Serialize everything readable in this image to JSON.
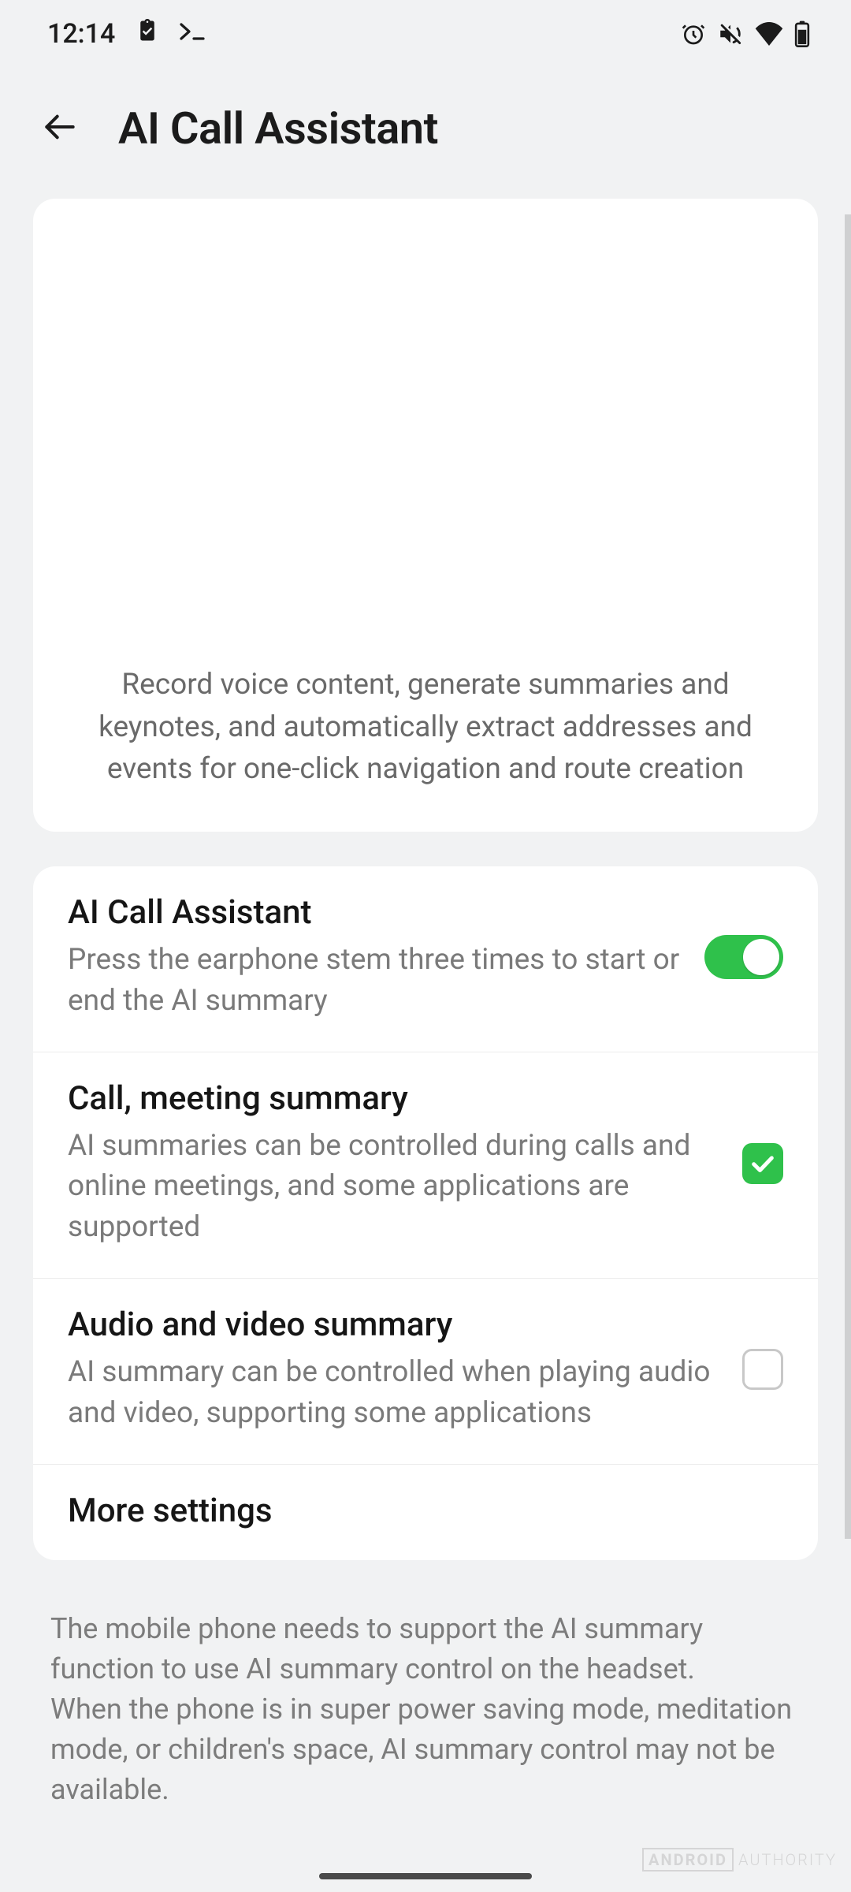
{
  "status": {
    "time": "12:14"
  },
  "header": {
    "title": "AI Call Assistant"
  },
  "hero": {
    "description": "Record voice content, generate summaries and keynotes, and automatically extract addresses and events for one-click navigation and route creation"
  },
  "settings": {
    "ai_call_assistant": {
      "title": "AI Call Assistant",
      "subtitle": "Press the earphone stem three times to start or end the AI summary",
      "enabled": true
    },
    "call_meeting_summary": {
      "title": "Call, meeting summary",
      "subtitle": "AI summaries can be controlled during calls and online meetings, and some applications are supported",
      "checked": true
    },
    "audio_video_summary": {
      "title": "Audio and video summary",
      "subtitle": "AI summary can be controlled when playing audio and video, supporting some applications",
      "checked": false
    },
    "more_settings": {
      "title": "More settings"
    }
  },
  "footnote": "The mobile phone needs to support the AI summary function to use AI summary control on the headset.\nWhen the phone is in super power saving mode, meditation mode, or children's space, AI summary control may not be available.",
  "watermark": {
    "brand": "ANDROID",
    "sub": "AUTHORITY"
  }
}
